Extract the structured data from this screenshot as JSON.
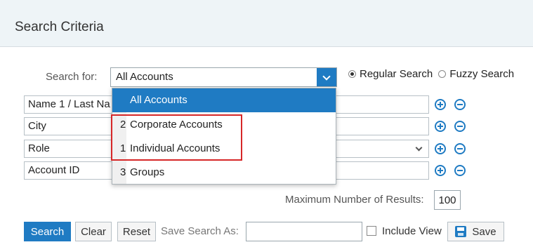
{
  "header": {
    "title": "Search Criteria"
  },
  "search_for": {
    "label": "Search for:",
    "selected": "All Accounts",
    "options": [
      {
        "num": "",
        "label": "All Accounts",
        "selected": true
      },
      {
        "num": "2",
        "label": "Corporate Accounts",
        "selected": false
      },
      {
        "num": "1",
        "label": "Individual Accounts",
        "selected": false
      },
      {
        "num": "3",
        "label": "Groups",
        "selected": false
      }
    ]
  },
  "search_type": {
    "regular_label": "Regular Search",
    "fuzzy_label": "Fuzzy Search",
    "selected": "regular"
  },
  "criteria": {
    "rows": [
      {
        "field": "Name 1 / Last Na",
        "value": ""
      },
      {
        "field": "City",
        "value": ""
      },
      {
        "field": "Role",
        "value": ""
      },
      {
        "field": "Account ID",
        "value": ""
      }
    ]
  },
  "max_results": {
    "label": "Maximum Number of Results:",
    "value": "100"
  },
  "footer": {
    "search_label": "Search",
    "clear_label": "Clear",
    "reset_label": "Reset",
    "save_search_as_label": "Save Search As:",
    "save_search_as_value": "",
    "include_view_label": "Include View",
    "save_label": "Save"
  },
  "colors": {
    "accent": "#1f7bc3",
    "highlight": "#d62728",
    "header_bg": "#eef4f7"
  },
  "icons": {
    "select_toggle": "chevron-down-icon",
    "add": "plus-circle-icon",
    "remove": "minus-circle-icon",
    "save": "floppy-disk-icon"
  }
}
